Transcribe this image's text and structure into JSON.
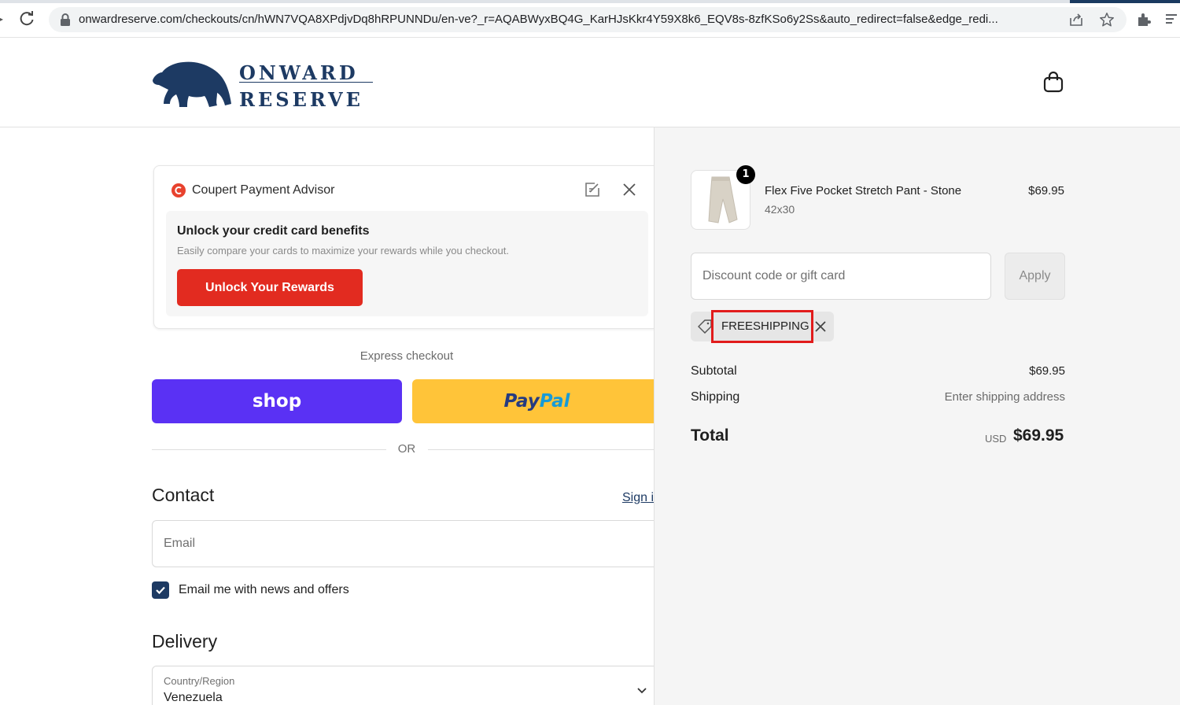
{
  "browser": {
    "url": "onwardreserve.com/checkouts/cn/hWN7VQA8XPdjvDq8hRPUNNDu/en-ve?_r=AQABWyxBQ4G_KarHJsKkr4Y59X8k6_EQV8s-8zfKSo6y2Ss&auto_redirect=false&edge_redi...",
    "icons": [
      "back-icon",
      "reload-icon",
      "lock-icon",
      "share-icon",
      "star-icon",
      "extensions-icon",
      "reading-list-icon"
    ]
  },
  "header": {
    "logo_line1": "ONWARD",
    "logo_line2": "RESERVE",
    "brand_color": "#1d3a63"
  },
  "coupert": {
    "title": "Coupert Payment Advisor",
    "heading": "Unlock your credit card benefits",
    "subtext": "Easily compare your cards to maximize your rewards while you checkout.",
    "button": "Unlock Your Rewards",
    "button_color": "#e22b20"
  },
  "express": {
    "label": "Express checkout",
    "shop_label": "shop",
    "paypal_part1": "Pay",
    "paypal_part2": "Pal",
    "or_label": "OR"
  },
  "contact": {
    "heading": "Contact",
    "signin": "Sign in",
    "email_placeholder": "Email",
    "newsletter_label": "Email me with news and offers",
    "newsletter_checked": true
  },
  "delivery": {
    "heading": "Delivery",
    "country_label": "Country/Region",
    "country_value": "Venezuela"
  },
  "summary": {
    "item": {
      "quantity": "1",
      "name": "Flex Five Pocket Stretch Pant - Stone",
      "variant": "42x30",
      "price": "$69.95"
    },
    "discount_placeholder": "Discount code or gift card",
    "apply_label": "Apply",
    "applied_code": "FREESHIPPING",
    "subtotal_label": "Subtotal",
    "subtotal_value": "$69.95",
    "shipping_label": "Shipping",
    "shipping_value": "Enter shipping address",
    "total_label": "Total",
    "currency": "USD",
    "total_value": "$69.95"
  }
}
